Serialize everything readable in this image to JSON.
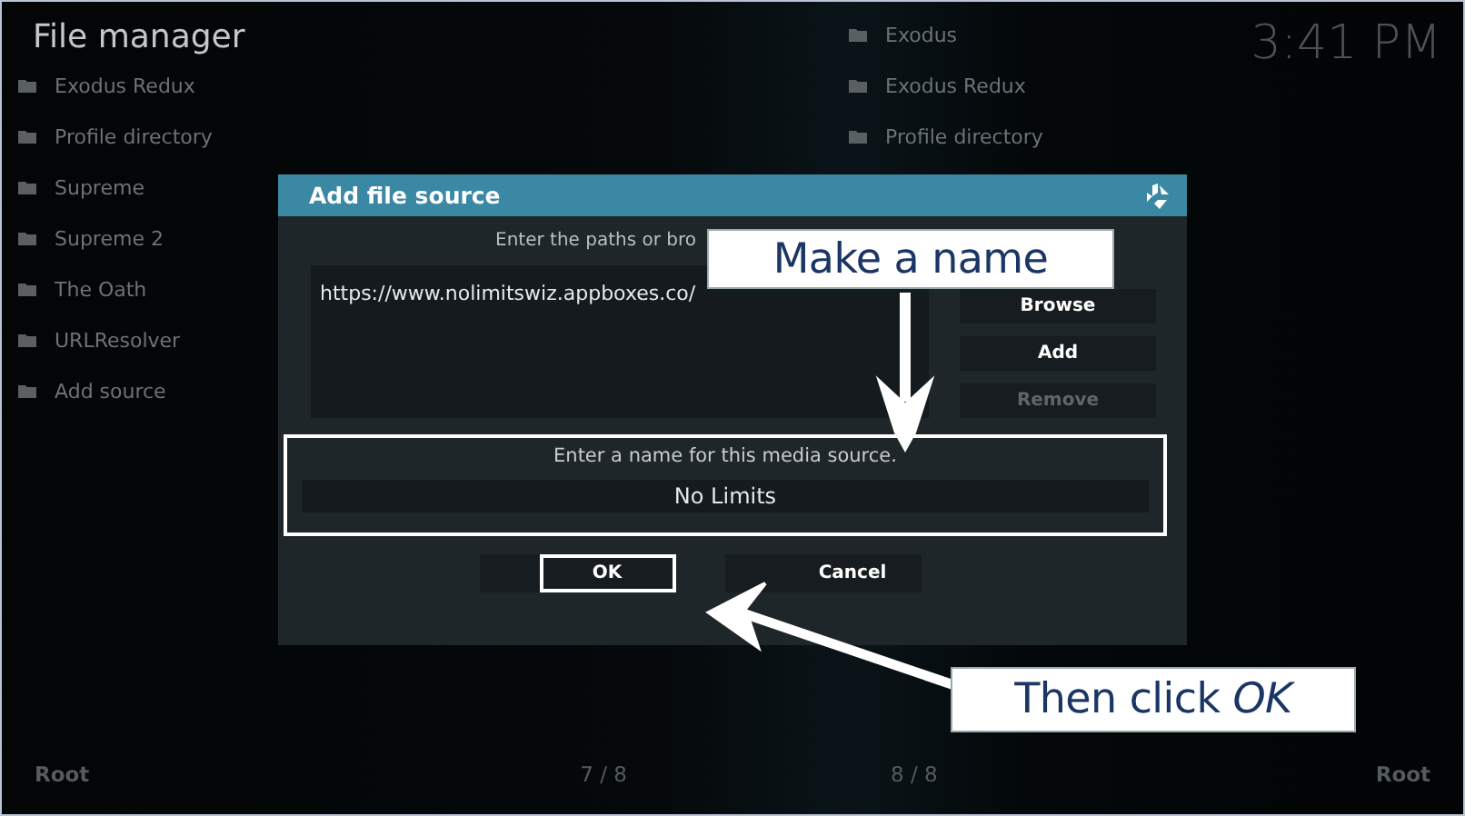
{
  "header": {
    "title": "File manager",
    "clock": "3:41 PM"
  },
  "left_list": {
    "items": [
      "Exodus Redux",
      "Profile directory",
      "Supreme",
      "Supreme 2",
      "The Oath",
      "URLResolver",
      "Add source"
    ]
  },
  "right_list": {
    "items": [
      "Exodus",
      "Exodus Redux",
      "Profile directory"
    ]
  },
  "dialog": {
    "title": "Add file source",
    "prompt": "Enter the paths or bro",
    "paths": [
      "https://www.nolimitswiz.appboxes.co/"
    ],
    "buttons": [
      {
        "label": "Browse",
        "disabled": false
      },
      {
        "label": "Add",
        "disabled": false
      },
      {
        "label": "Remove",
        "disabled": true
      }
    ],
    "name_prompt": "Enter a name for this media source.",
    "name_value": "No Limits",
    "actions": [
      {
        "label": "OK",
        "focused": true
      },
      {
        "label": "Cancel",
        "focused": false
      }
    ]
  },
  "annotations": [
    {
      "text": "Make a name"
    },
    {
      "text": "Then click *OK*"
    }
  ],
  "footer": {
    "left_path": "Root",
    "left_count": "7 / 8",
    "right_count": "8 / 8",
    "right_path": "Root"
  }
}
